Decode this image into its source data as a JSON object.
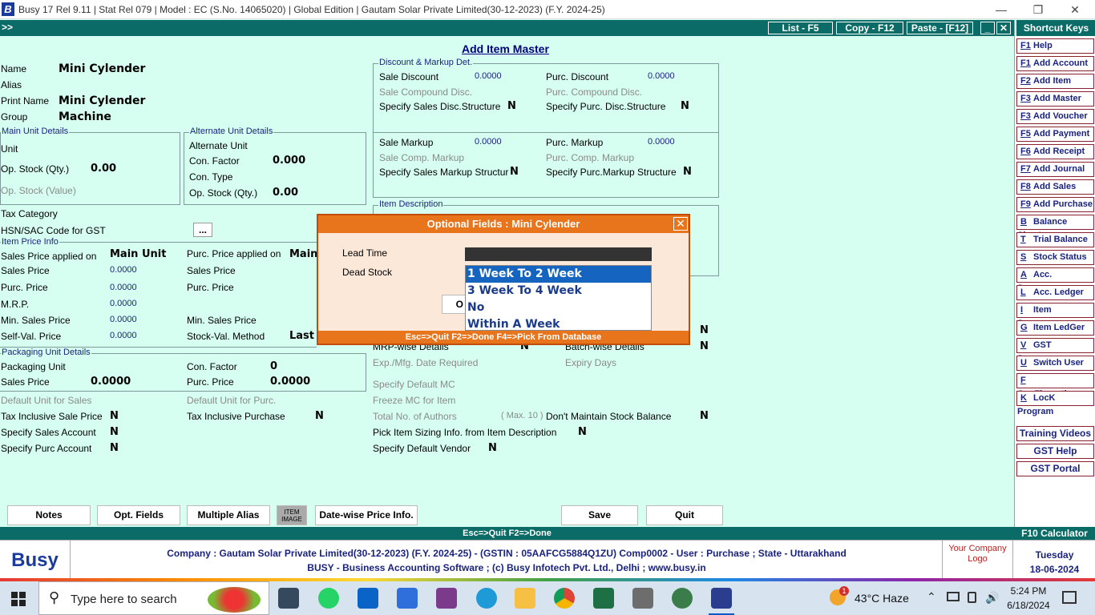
{
  "window": {
    "title": "Busy 17  Rel 9.11  |  Stat Rel 079  |  Model : EC (S.No. 14065020)  |  Global Edition  |  Gautam Solar Private Limited(30-12-2023) (F.Y. 2024-25)",
    "logo": "B",
    "minimize": "—",
    "restore": "❐",
    "close": "✕"
  },
  "toolbar": {
    "expand": ">>",
    "list": "List - F5",
    "copy": "Copy - F12",
    "paste": "Paste - [F12]",
    "min": "_",
    "close": "✕"
  },
  "form": {
    "heading": "Add Item Master",
    "name_label": "Name",
    "name_value": "Mini Cylender",
    "alias_label": "Alias",
    "print_name_label": "Print Name",
    "print_name_value": "Mini Cylender",
    "group_label": "Group",
    "group_value": "Machine",
    "main_unit_legend": "Main Unit Details",
    "unit_label": "Unit",
    "op_stock_qty_label": "Op. Stock (Qty.)",
    "op_stock_qty_value": "0.00",
    "op_stock_value_label": "Op. Stock (Value)",
    "alt_unit_legend": "Alternate Unit Details",
    "alt_unit_label": "Alternate Unit",
    "con_factor_label": "Con. Factor",
    "con_factor_value": "0.000",
    "con_type_label": "Con. Type",
    "alt_op_stock_label": "Op. Stock (Qty.)",
    "alt_op_stock_value": "0.00",
    "tax_category_label": "Tax Category",
    "hsn_label": "HSN/SAC Code for GST",
    "hsn_btn": "...",
    "price_legend": "Item Price Info",
    "sales_price_applied_label": "Sales Price applied on",
    "sales_price_applied_value": "Main Unit",
    "purc_price_applied_label": "Purc. Price applied on",
    "purc_price_applied_value": "Main",
    "sales_price_label": "Sales Price",
    "sales_price_value": "0.0000",
    "purc_price_label": "Purc. Price",
    "purc_price_value": "0.0000",
    "mrp_label": "M.R.P.",
    "mrp_value": "0.0000",
    "min_sales_price_label": "Min. Sales Price",
    "min_sales_price_value": "0.0000",
    "self_val_label": "Self-Val. Price",
    "self_val_value": "0.0000",
    "alt_sales_price_label": "Sales Price",
    "alt_purc_price_label": "Purc. Price",
    "alt_min_sales_label": "Min. Sales Price",
    "stock_val_method_label": "Stock-Val. Method",
    "stock_val_method_value": "Last",
    "pkg_legend": "Packaging Unit Details",
    "pkg_unit_label": "Packaging Unit",
    "pkg_con_factor_label": "Con. Factor",
    "pkg_con_factor_value": "0",
    "pkg_sales_price_label": "Sales Price",
    "pkg_sales_price_value": "0.0000",
    "pkg_purc_price_label": "Purc. Price",
    "pkg_purc_price_value": "0.0000",
    "default_unit_sales_label": "Default Unit for Sales",
    "default_unit_purc_label": "Default Unit for Purc.",
    "tax_incl_sale_label": "Tax Inclusive Sale Price",
    "tax_incl_sale_value": "N",
    "tax_incl_purc_label": "Tax Inclusive Purchase",
    "tax_incl_purc_value": "N",
    "spec_sales_acc_label": "Specify Sales Account",
    "spec_sales_acc_value": "N",
    "spec_purc_acc_label": "Specify Purc Account",
    "spec_purc_acc_value": "N"
  },
  "discount": {
    "legend": "Discount & Markup Det.",
    "sale_discount_label": "Sale Discount",
    "sale_discount_value": "0.0000",
    "purc_discount_label": "Purc. Discount",
    "purc_discount_value": "0.0000",
    "sale_comp_disc_label": "Sale Compound Disc.",
    "purc_comp_disc_label": "Purc. Compound Disc.",
    "spec_sales_disc_label": "Specify Sales Disc.Structure",
    "spec_sales_disc_value": "N",
    "spec_purc_disc_label": "Specify  Purc. Disc.Structure",
    "spec_purc_disc_value": "N",
    "sale_markup_label": "Sale Markup",
    "sale_markup_value": "0.0000",
    "purc_markup_label": "Purc. Markup",
    "purc_markup_value": "0.0000",
    "sale_comp_markup_label": "Sale Comp. Markup",
    "purc_comp_markup_label": "Purc. Comp. Markup",
    "spec_sales_markup_label": "Specify Sales Markup Structure",
    "spec_sales_markup_value": "N",
    "spec_purc_markup_label": "Specify  Purc.Markup Structure",
    "spec_purc_markup_value": "N",
    "item_desc_legend": "Item Description"
  },
  "right": {
    "n1": "N",
    "mrp_wise_label": "MRP-wise Details",
    "mrp_wise_value": "N",
    "batch_wise_label": "Batch-wise Details",
    "batch_wise_value": "N",
    "exp_mfg_label": "Exp./Mfg. Date Required",
    "expiry_days_label": "Expiry Days",
    "spec_default_mc_label": "Specify Default MC",
    "freeze_mc_label": "Freeze MC for Item",
    "total_authors_label": "Total No. of Authors",
    "total_authors_hint": "( Max. 10 )",
    "dont_maintain_label": "Don't Maintain Stock Balance",
    "dont_maintain_value": "N",
    "pick_sizing_label": "Pick Item Sizing Info. from Item Description",
    "pick_sizing_value": "N",
    "spec_vendor_label": "Specify Default Vendor",
    "spec_vendor_value": "N"
  },
  "popup": {
    "title": "Optional Fields : Mini Cylender",
    "close": "✕",
    "lead_time_label": "Lead Time",
    "dead_stock_label": "Dead Stock",
    "hidden_btn": "O",
    "options": [
      "1 Week To 2 Week",
      "3 Week To 4 Week",
      "No",
      "Within A Week"
    ],
    "footer": "Esc=>Quit    F2=>Done    F4=>Pick From Database"
  },
  "buttons": {
    "notes": "Notes",
    "opt_fields": "Opt. Fields",
    "multiple_alias": "Multiple Alias",
    "item_image": "ITEM IMAGE",
    "date_wise": "Date-wise Price Info.",
    "save": "Save",
    "quit": "Quit"
  },
  "status": {
    "text": "Esc=>Quit   F2=>Done",
    "f10": "F10 Calculator"
  },
  "shortcuts": {
    "title": "Shortcut Keys",
    "items": [
      {
        "key": "F1",
        "label": "Help"
      },
      {
        "key": "F1",
        "label": "Add Account"
      },
      {
        "key": "F2",
        "label": "Add Item"
      },
      {
        "key": "F3",
        "label": "Add Master"
      },
      {
        "key": "F3",
        "label": "Add Voucher"
      },
      {
        "key": "F5",
        "label": "Add Payment"
      },
      {
        "key": "F6",
        "label": "Add Receipt"
      },
      {
        "key": "F7",
        "label": "Add Journal"
      },
      {
        "key": "F8",
        "label": "Add Sales"
      },
      {
        "key": "F9",
        "label": "Add Purchase"
      },
      {
        "key": "B",
        "label": "Balance Sheet"
      },
      {
        "key": "T",
        "label": "Trial Balance"
      },
      {
        "key": "S",
        "label": "Stock Status"
      },
      {
        "key": "A",
        "label": "Acc. Summary"
      },
      {
        "key": "L",
        "label": "Acc. Ledger"
      },
      {
        "key": "I",
        "label": "Item Summary"
      },
      {
        "key": "G",
        "label": "Item LedGer"
      },
      {
        "key": "V",
        "label": "GST Summary"
      },
      {
        "key": "U",
        "label": "Switch User"
      },
      {
        "key": "F",
        "label": "ConFiguration"
      },
      {
        "key": "K",
        "label": "LocK Program"
      }
    ],
    "training": "Training Videos",
    "gst_help": "GST Help",
    "gst_portal": "GST Portal"
  },
  "footer": {
    "logo": "Busy",
    "line1": "Company : Gautam Solar Private Limited(30-12-2023) (F.Y. 2024-25) - (GSTIN : 05AAFCG5884Q1ZU) Comp0002 - User : Purchase ; State - Uttarakhand",
    "line2": "BUSY - Business Accounting Software   ;   (c) Busy Infotech Pvt. Ltd., Delhi   ;   www.busy.in",
    "company_logo": "Your Company Logo",
    "day": "Tuesday",
    "date": "18-06-2024"
  },
  "taskbar": {
    "search_placeholder": "Type here to search",
    "weather": "43°C  Haze",
    "notification_count": "1",
    "time": "5:24 PM",
    "date": "6/18/2024",
    "apps": [
      "task-view-icon",
      "whatsapp-icon",
      "mail-icon",
      "store-icon",
      "winrar-icon",
      "edge-icon",
      "file-explorer-icon",
      "chrome-icon",
      "excel-icon",
      "calculator-icon",
      "tally-icon",
      "busy-icon"
    ]
  },
  "colors": {
    "background": "#d6fff1",
    "teal": "#0b6b66",
    "popup_header": "#e8741c",
    "selection": "#1565c0"
  }
}
